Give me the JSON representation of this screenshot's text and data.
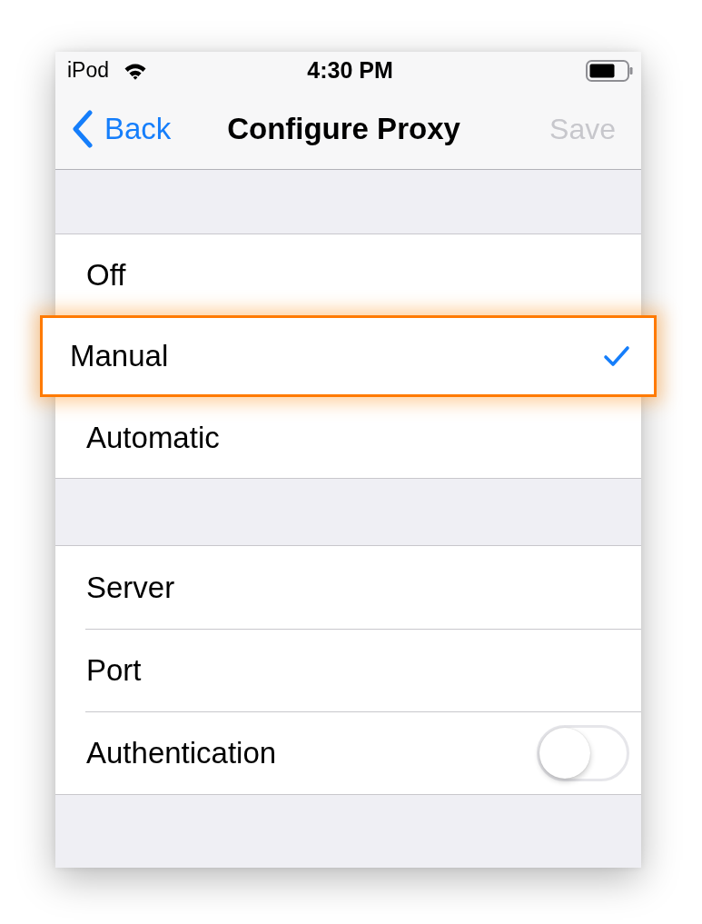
{
  "status_bar": {
    "carrier": "iPod",
    "time": "4:30 PM"
  },
  "nav_bar": {
    "back": "Back",
    "title": "Configure Proxy",
    "save": {
      "label": "Save",
      "disabled": true
    }
  },
  "proxy_modes": [
    {
      "label": "Off",
      "selected": false,
      "highlighted": false
    },
    {
      "label": "Manual",
      "selected": true,
      "highlighted": true
    },
    {
      "label": "Automatic",
      "selected": false,
      "highlighted": false
    }
  ],
  "settings": [
    {
      "kind": "link",
      "label": "Server"
    },
    {
      "kind": "link",
      "label": "Port"
    },
    {
      "kind": "toggle",
      "label": "Authentication",
      "on": false
    }
  ]
}
